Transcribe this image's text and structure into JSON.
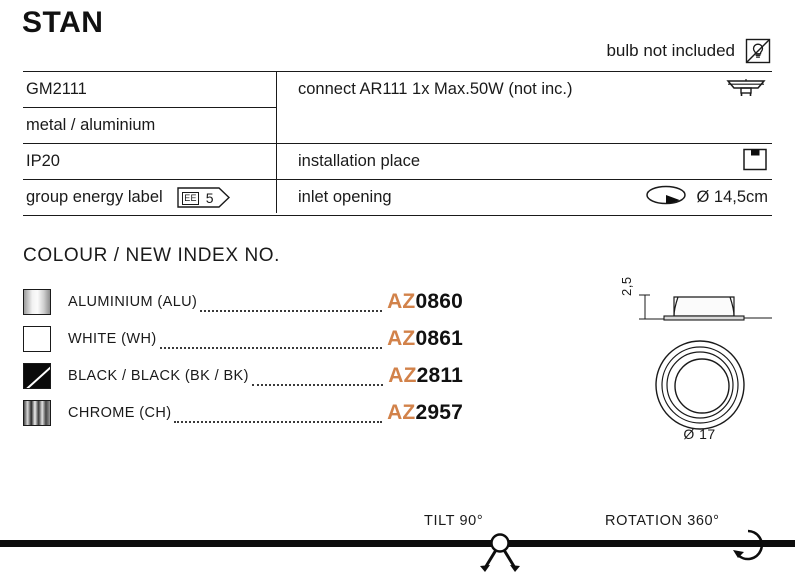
{
  "product": {
    "title": "STAN"
  },
  "notice": {
    "text": "bulb not included",
    "icon": "bulb-crossed-out-icon"
  },
  "spec_table": {
    "rows": [
      {
        "left": "GM2111",
        "right": "connect AR111 1x Max.50W (not inc.)",
        "right_icon": "ar111-lamp-icon"
      },
      {
        "left": "metal / aluminium",
        "right": "",
        "right_icon": ""
      },
      {
        "left": "IP20",
        "right": "installation place",
        "right_icon": "recessed-ceiling-icon"
      },
      {
        "left": "group energy label",
        "right": "inlet opening",
        "right_icon": "inlet-opening-icon",
        "right_value": "Ø 14,5cm",
        "badge": {
          "prefix": "EE",
          "value": "5"
        }
      }
    ]
  },
  "colour_section": {
    "heading": "COLOUR / NEW INDEX NO.",
    "accent_color": "#d2824a",
    "items": [
      {
        "swatch": "aluminium-swatch",
        "name": "ALUMINIUM (ALU)",
        "code_prefix": "AZ",
        "code_number": "0860"
      },
      {
        "swatch": "white-swatch",
        "name": "WHITE (WH)",
        "code_prefix": "AZ",
        "code_number": "0861"
      },
      {
        "swatch": "black-swatch",
        "name": "BLACK / BLACK (BK / BK)",
        "code_prefix": "AZ",
        "code_number": "2811"
      },
      {
        "swatch": "chrome-swatch",
        "name": "CHROME (CH)",
        "code_prefix": "AZ",
        "code_number": "2957"
      }
    ]
  },
  "technical_drawing": {
    "height_label": "2,5",
    "diameter_label": "Ø 17"
  },
  "movement": {
    "tilt_label": "TILT 90°",
    "rotation_label": "ROTATION 360°"
  }
}
